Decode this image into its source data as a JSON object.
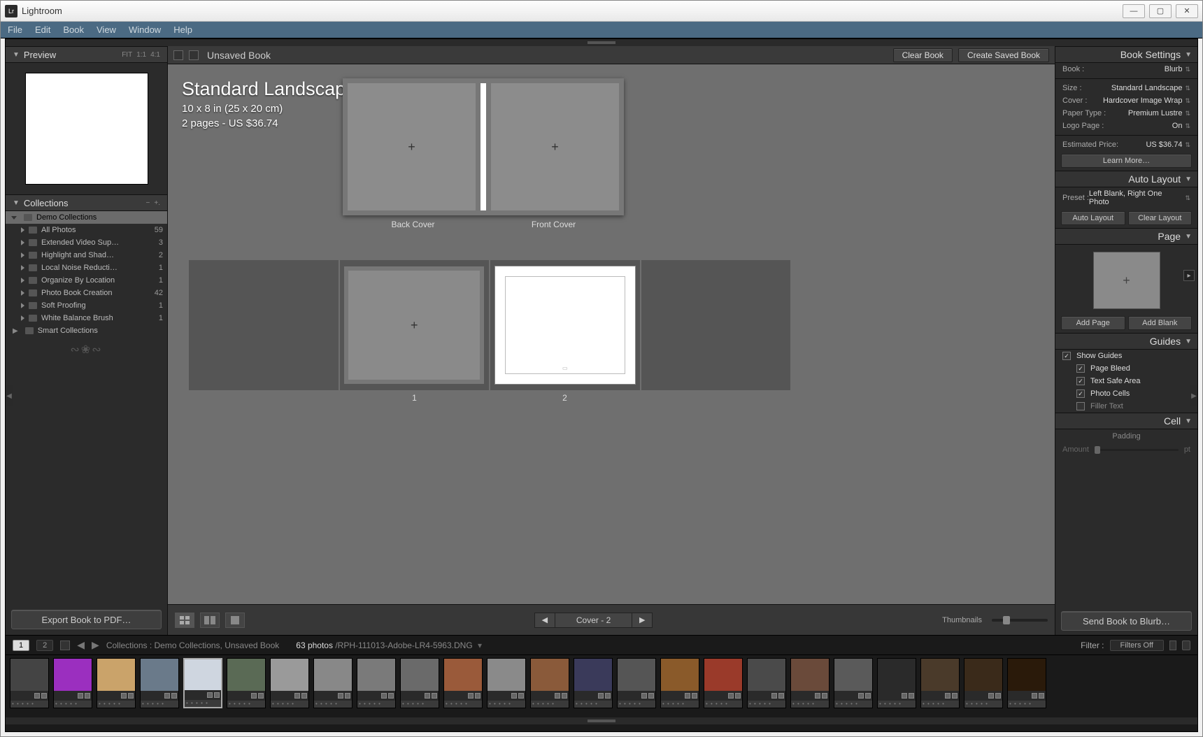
{
  "window": {
    "title": "Lightroom"
  },
  "menu": [
    "File",
    "Edit",
    "Book",
    "View",
    "Window",
    "Help"
  ],
  "left": {
    "preview_header": "Preview",
    "preview_fit": "FIT",
    "preview_11": "1:1",
    "preview_41": "4:1",
    "collections_header": "Collections",
    "demo_header": "Demo Collections",
    "items": [
      {
        "name": "All Photos",
        "count": "59"
      },
      {
        "name": "Extended Video Sup…",
        "count": "3"
      },
      {
        "name": "Highlight and Shad…",
        "count": "2"
      },
      {
        "name": "Local Noise Reducti…",
        "count": "1"
      },
      {
        "name": "Organize By Location",
        "count": "1"
      },
      {
        "name": "Photo Book Creation",
        "count": "42"
      },
      {
        "name": "Soft Proofing",
        "count": "1"
      },
      {
        "name": "White Balance Brush",
        "count": "1"
      }
    ],
    "smart": "Smart Collections",
    "export": "Export Book to PDF…"
  },
  "center": {
    "book_name": "Unsaved Book",
    "clear": "Clear Book",
    "create": "Create Saved Book",
    "title": "Standard Landscape",
    "sub1": "10 x 8 in (25 x 20 cm)",
    "sub2": "2 pages - US $36.74",
    "back_cover": "Back Cover",
    "front_cover": "Front Cover",
    "page1": "1",
    "page2": "2",
    "nav_label": "Cover - 2",
    "thumbnails": "Thumbnails"
  },
  "right": {
    "book_settings": "Book Settings",
    "rows": {
      "book": {
        "label": "Book :",
        "value": "Blurb"
      },
      "size": {
        "label": "Size :",
        "value": "Standard Landscape"
      },
      "cover": {
        "label": "Cover :",
        "value": "Hardcover Image Wrap"
      },
      "paper": {
        "label": "Paper Type :",
        "value": "Premium Lustre"
      },
      "logo": {
        "label": "Logo Page :",
        "value": "On"
      },
      "price": {
        "label": "Estimated Price:",
        "value": "US $36.74"
      }
    },
    "learn_more": "Learn More…",
    "auto_layout_header": "Auto Layout",
    "preset": {
      "label": "Preset :",
      "value": "Left Blank, Right One Photo"
    },
    "auto_layout_btn": "Auto Layout",
    "clear_layout_btn": "Clear Layout",
    "page_header": "Page",
    "add_page": "Add Page",
    "add_blank": "Add Blank",
    "guides_header": "Guides",
    "show_guides": "Show Guides",
    "page_bleed": "Page Bleed",
    "text_safe": "Text Safe Area",
    "photo_cells": "Photo Cells",
    "filler_text": "Filler Text",
    "cell_header": "Cell",
    "padding": "Padding",
    "amount": "Amount",
    "pt": "pt",
    "send": "Send Book to Blurb…"
  },
  "info": {
    "badge1": "1",
    "badge2": "2",
    "breadcrumb": "Collections : Demo Collections, Unsaved Book",
    "photo_count": "63 photos",
    "file": "/RPH-111013-Adobe-LR4-5963.DNG",
    "filter_label": "Filter :",
    "filter_value": "Filters Off"
  },
  "film_colors": [
    "#444",
    "#9b2fbf",
    "#caa36a",
    "#6a7a8a",
    "#cfd6e0",
    "#5a6a55",
    "#9a9a9a",
    "#888",
    "#7a7a7a",
    "#6a6a6a",
    "#9a5a3a",
    "#8a8a8a",
    "#8a5a3a",
    "#3a3a5a",
    "#555",
    "#8a5a2a",
    "#9a3a2a",
    "#4a4a4a",
    "#6a4a3a",
    "#5a5a5a",
    "#2a2a2a",
    "#4a3a2a",
    "#3a2a1a",
    "#2a1a0a"
  ]
}
